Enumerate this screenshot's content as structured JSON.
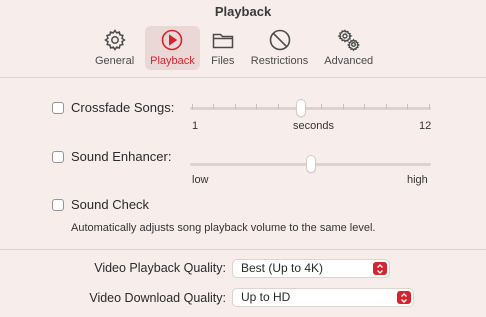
{
  "window": {
    "title": "Playback"
  },
  "toolbar": {
    "tabs": [
      {
        "label": "General",
        "icon": "gear-icon",
        "active": false
      },
      {
        "label": "Playback",
        "icon": "play-circle-icon",
        "active": true
      },
      {
        "label": "Files",
        "icon": "folder-icon",
        "active": false
      },
      {
        "label": "Restrictions",
        "icon": "no-entry-icon",
        "active": false
      },
      {
        "label": "Advanced",
        "icon": "gears-icon",
        "active": false
      }
    ]
  },
  "crossfade": {
    "label": "Crossfade Songs:",
    "checked": false,
    "min_label": "1",
    "unit_label": "seconds",
    "max_label": "12",
    "value": 6
  },
  "enhancer": {
    "label": "Sound Enhancer:",
    "checked": false,
    "min_label": "low",
    "max_label": "high",
    "level": 0.5
  },
  "sound_check": {
    "label": "Sound Check",
    "checked": false,
    "description": "Automatically adjusts song playback volume to the same level."
  },
  "video": {
    "playback_label": "Video Playback Quality:",
    "playback_value": "Best (Up to 4K)",
    "download_label": "Video Download Quality:",
    "download_value": "Up to HD"
  },
  "colors": {
    "accent": "#d6242f",
    "background": "#f7eeec"
  }
}
